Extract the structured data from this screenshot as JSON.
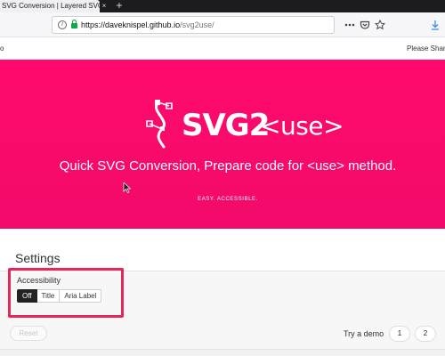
{
  "browser": {
    "tab_title": "SVG Conversion | Layered SVG",
    "tab_close": "×",
    "new_tab": "+",
    "url_host": "https://daveknispel.github.io",
    "url_path": "/svg2use/",
    "icons": [
      "info-icon",
      "lock-icon",
      "reader-icon",
      "bookmark-icon",
      "pocket-icon",
      "menu-icon",
      "download-icon"
    ]
  },
  "site": {
    "left_text": "o",
    "right_text": "Please Share"
  },
  "hero": {
    "logo_svg2": "SVG2",
    "logo_use": "<use>",
    "subtitle": "Quick SVG Conversion, Prepare code for <use> method.",
    "tagline": "EASY. ACCESSIBLE.",
    "background": "#ff0a6c"
  },
  "settings": {
    "title": "Settings",
    "accessibility_label": "Accessibility",
    "options": [
      "Off",
      "Title",
      "Aria Label"
    ],
    "selected": "Off",
    "highlight_color": "#e4285a"
  },
  "actions": {
    "reset_label": "Reset",
    "demo_label": "Try a demo",
    "demo_1": "1",
    "demo_2": "2"
  }
}
